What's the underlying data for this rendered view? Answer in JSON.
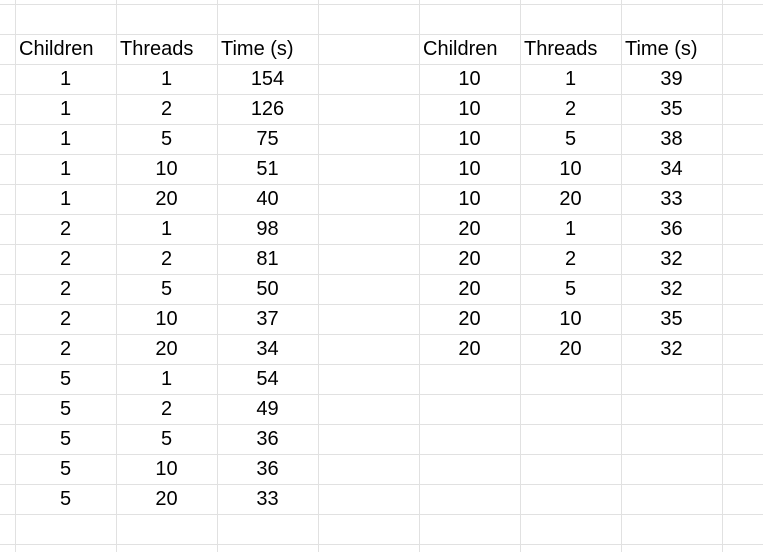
{
  "left_table": {
    "headers": [
      "Children",
      "Threads",
      "Time (s)"
    ],
    "rows": [
      [
        "1",
        "1",
        "154"
      ],
      [
        "1",
        "2",
        "126"
      ],
      [
        "1",
        "5",
        "75"
      ],
      [
        "1",
        "10",
        "51"
      ],
      [
        "1",
        "20",
        "40"
      ],
      [
        "2",
        "1",
        "98"
      ],
      [
        "2",
        "2",
        "81"
      ],
      [
        "2",
        "5",
        "50"
      ],
      [
        "2",
        "10",
        "37"
      ],
      [
        "2",
        "20",
        "34"
      ],
      [
        "5",
        "1",
        "54"
      ],
      [
        "5",
        "2",
        "49"
      ],
      [
        "5",
        "5",
        "36"
      ],
      [
        "5",
        "10",
        "36"
      ],
      [
        "5",
        "20",
        "33"
      ]
    ]
  },
  "right_table": {
    "headers": [
      "Children",
      "Threads",
      "Time (s)"
    ],
    "rows": [
      [
        "10",
        "1",
        "39"
      ],
      [
        "10",
        "2",
        "35"
      ],
      [
        "10",
        "5",
        "38"
      ],
      [
        "10",
        "10",
        "34"
      ],
      [
        "10",
        "20",
        "33"
      ],
      [
        "20",
        "1",
        "36"
      ],
      [
        "20",
        "2",
        "32"
      ],
      [
        "20",
        "5",
        "32"
      ],
      [
        "20",
        "10",
        "35"
      ],
      [
        "20",
        "20",
        "32"
      ]
    ]
  },
  "grid_color": "#e1e1e1"
}
